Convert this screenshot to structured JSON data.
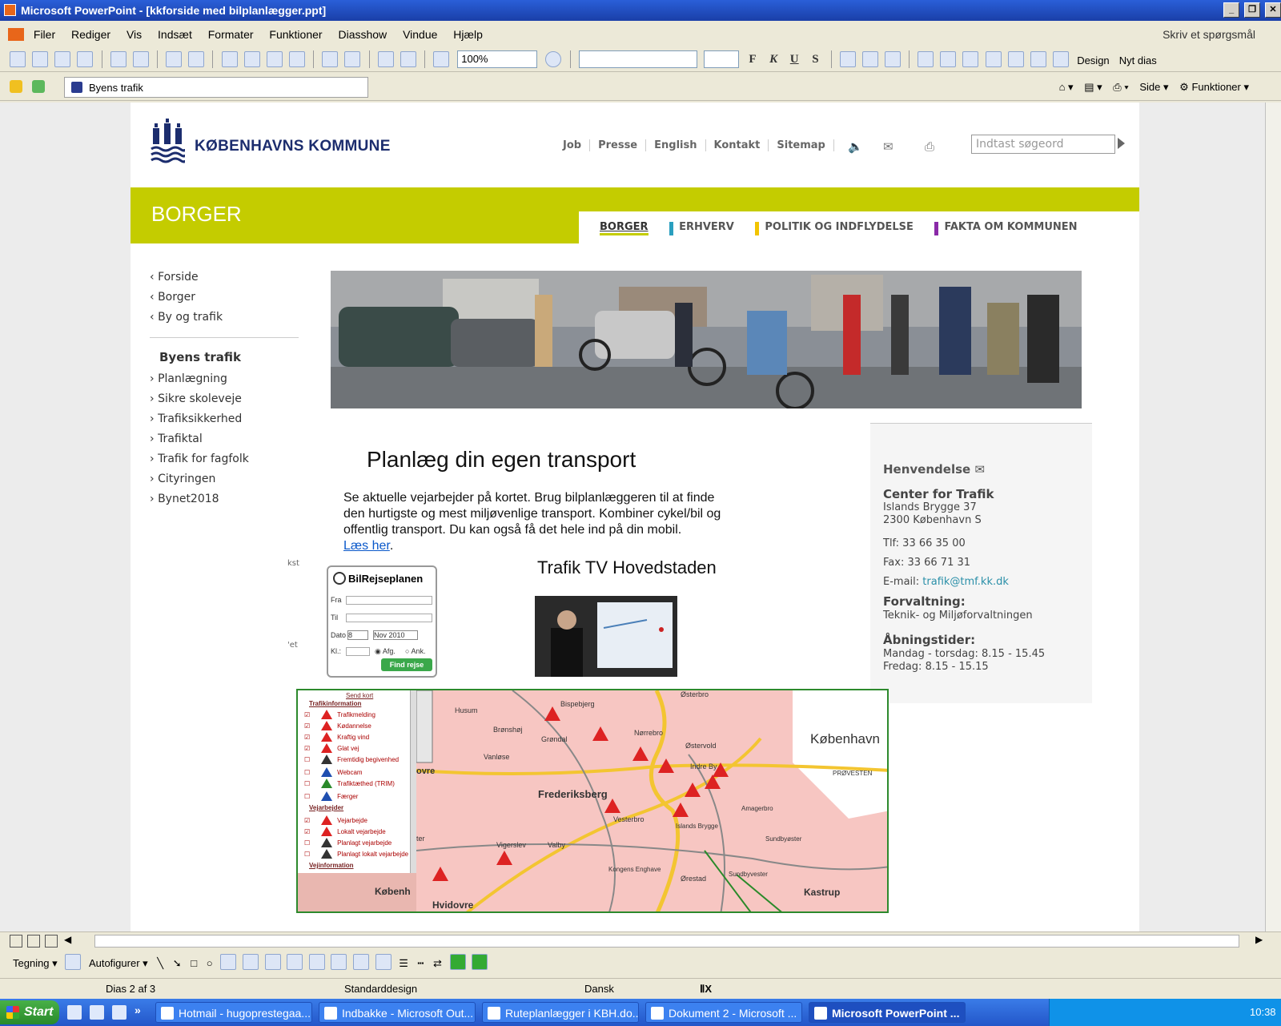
{
  "window": {
    "title": "Microsoft PowerPoint - [kkforside med bilplanlægger.ppt]",
    "controls": [
      "_",
      "❐",
      "✕"
    ]
  },
  "menu": {
    "items": [
      "Filer",
      "Rediger",
      "Vis",
      "Indsæt",
      "Formater",
      "Funktioner",
      "Diasshow",
      "Vindue",
      "Hjælp"
    ],
    "ask_placeholder": "Skriv et spørgsmål"
  },
  "toolbar": {
    "zoom": "100%",
    "format_buttons": [
      "F",
      "K",
      "U",
      "S"
    ],
    "design_label": "Design",
    "new_slide_label": "Nyt dias"
  },
  "links_bar": {
    "tab_label": "Byens trafik",
    "side_label": "Side",
    "functions_label": "Funktioner"
  },
  "site": {
    "brand": "KØBENHAVNS KOMMUNE",
    "top_links": [
      "Job",
      "Presse",
      "English",
      "Kontakt",
      "Sitemap"
    ],
    "search_placeholder": "Indtast søgeord",
    "section_title": "BORGER",
    "sections": [
      {
        "label": "BORGER",
        "color": "#c4cc00"
      },
      {
        "label": "ERHVERV",
        "color": "#2a9fbf"
      },
      {
        "label": "POLITIK OG INDFLYDELSE",
        "color": "#f2c400"
      },
      {
        "label": "FAKTA OM KOMMUNEN",
        "color": "#8a2aa8"
      }
    ],
    "breadcrumbs": [
      "Forside",
      "Borger",
      "By og trafik"
    ],
    "subnav_title": "Byens trafik",
    "subnav": [
      "Planlægning",
      "Sikre skoleveje",
      "Trafiksikkerhed",
      "Trafiktal",
      "Trafik for fagfolk",
      "Cityringen",
      "Bynet2018"
    ]
  },
  "slide": {
    "heading": "Planlæg din egen transport",
    "body": "Se aktuelle vejarbejder på kortet. Brug bilplanlæggeren til at finde den hurtigste og mest miljøvenlige transport. Kombiner cykel/bil og offentlig transport. Du kan også få det hele ind på din mobil.",
    "link": "Læs her",
    "tv_heading": "Trafik TV Hovedstaden",
    "snippet1": "kst",
    "snippet2": "'et"
  },
  "widget": {
    "title": "BilRejseplanen",
    "fra": "Fra",
    "til": "Til",
    "dato": "Dato",
    "day": "8",
    "month": "Nov 2010",
    "kl": "Kl.:",
    "afg": "Afg.",
    "ank": "Ank.",
    "button": "Find rejse"
  },
  "contact": {
    "heading": "Henvendelse",
    "org": "Center for Trafik",
    "street": "Islands Brygge 37",
    "city": "2300 København S",
    "tlf": "Tlf: 33 66 35 00",
    "fax": "Fax: 33 66 71 31",
    "email_label": "E-mail:",
    "email": "trafik@tmf.kk.dk",
    "admin_label": "Forvaltning:",
    "admin": "Teknik- og Miljøforvaltningen",
    "hours_label": "Åbningstider:",
    "hours1": "Mandag - torsdag: 8.15 - 15.45",
    "hours2": "Fredag: 8.15 - 15.15"
  },
  "map": {
    "send_kort": "Send kort",
    "legend_sections": [
      "Trafikinformation",
      "Vejarbejder",
      "Vejinformation"
    ],
    "legend_items": [
      "Trafikmelding",
      "Kødannelse",
      "Kraftig vind",
      "Glat vej",
      "Fremtidig begivenhed",
      "Webcam",
      "Trafiktæthed (TRIM)",
      "Færger",
      "Vejarbejde",
      "Lokalt vejarbejde",
      "Planlagt vejarbejde",
      "Planlagt lokalt vejarbejde"
    ],
    "places": [
      "Østerbro",
      "Husum",
      "Bispebjerg",
      "Brønshøj",
      "Nørrebro",
      "Grøndal",
      "Østervold",
      "København",
      "Vanløse",
      "Indre By",
      "ovre",
      "PRØVESTEN",
      "Frederiksberg",
      "Amagerbro",
      "Vesterbro",
      "Islands Brygge",
      "ter",
      "Vigerslev",
      "Valby",
      "Sundbyøster",
      "Kongens Enghave",
      "Ørestad",
      "Sundbyvester",
      "Kastrup",
      "Hvidovre",
      "Københ"
    ]
  },
  "drawbar": {
    "drawing_label": "Tegning",
    "autoshapes_label": "Autofigurer"
  },
  "status": {
    "slide": "Dias 2 af 3",
    "design": "Standarddesign",
    "language": "Dansk"
  },
  "taskbar": {
    "start": "Start",
    "tasks": [
      "Hotmail - hugoprestegaa...",
      "Indbakke - Microsoft Out...",
      "Ruteplanlægger i KBH.do...",
      "Dokument 2 - Microsoft ...",
      "Microsoft PowerPoint ..."
    ],
    "clock": "10:38"
  }
}
